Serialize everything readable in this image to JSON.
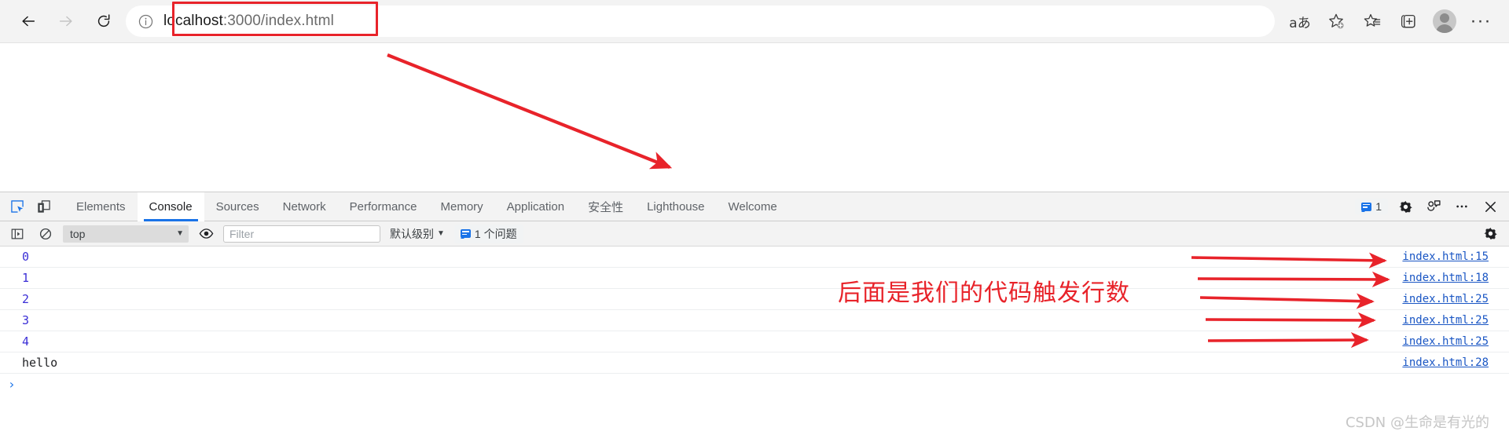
{
  "browser": {
    "nav": {
      "back_label": "Back",
      "forward_label": "Forward",
      "refresh_label": "Refresh"
    },
    "address": {
      "info_icon": "info-circle-icon",
      "host": "localhost",
      "rest": ":3000/index.html",
      "full_url": "localhost:3000/index.html"
    },
    "toolbar_icons": [
      {
        "name": "read-aloud-icon",
        "glyph": "aあ"
      },
      {
        "name": "add-favorite-icon",
        "glyph": "☆"
      },
      {
        "name": "favorites-icon",
        "glyph": "☆"
      },
      {
        "name": "collections-icon",
        "glyph": "⊕"
      },
      {
        "name": "profile-avatar",
        "glyph": ""
      },
      {
        "name": "settings-and-more-icon",
        "glyph": "···"
      }
    ]
  },
  "devtools": {
    "left_icons": [
      {
        "name": "inspect-element-icon",
        "active": true
      },
      {
        "name": "device-toolbar-icon",
        "active": false
      }
    ],
    "tabs": [
      {
        "label": "Elements",
        "active": false
      },
      {
        "label": "Console",
        "active": true
      },
      {
        "label": "Sources",
        "active": false
      },
      {
        "label": "Network",
        "active": false
      },
      {
        "label": "Performance",
        "active": false
      },
      {
        "label": "Memory",
        "active": false
      },
      {
        "label": "Application",
        "active": false
      },
      {
        "label": "安全性",
        "active": false
      },
      {
        "label": "Lighthouse",
        "active": false
      },
      {
        "label": "Welcome",
        "active": false
      }
    ],
    "tabbar_right": {
      "issues_count": "1",
      "settings_icon": "gear-icon",
      "feedback_icon": "feedback-icon",
      "more_icon": "more-options-icon",
      "close_icon": "close-icon"
    },
    "console_toolbar": {
      "sidebar_toggle_icon": "console-sidebar-icon",
      "clear_console_icon": "clear-console-icon",
      "context_selected": "top",
      "live_expression_icon": "eye-icon",
      "filter_placeholder": "Filter",
      "filter_value": "",
      "levels_label": "默认级别",
      "issues_badge": "1 个问题",
      "settings_icon": "console-settings-gear-icon"
    },
    "console_rows": [
      {
        "message": "0",
        "type": "number",
        "source": "index.html:15"
      },
      {
        "message": "1",
        "type": "number",
        "source": "index.html:18"
      },
      {
        "message": "2",
        "type": "number",
        "source": "index.html:25"
      },
      {
        "message": "3",
        "type": "number",
        "source": "index.html:25"
      },
      {
        "message": "4",
        "type": "number",
        "source": "index.html:25"
      },
      {
        "message": "hello",
        "type": "string",
        "source": "index.html:28"
      }
    ],
    "prompt_caret": "›"
  },
  "annotations": {
    "red_text": "后面是我们的代码触发行数",
    "accent_color": "#e8232a"
  },
  "watermark": {
    "text": "CSDN @生命是有光的"
  }
}
